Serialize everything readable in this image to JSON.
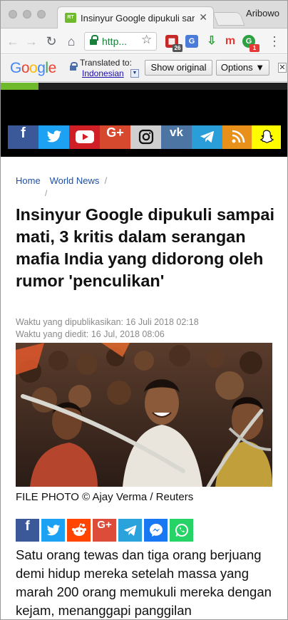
{
  "browser": {
    "tab_title": "Insinyur Google dipukuli samp",
    "tab_favicon_text": "RT",
    "profile_name": "Aribowo",
    "url": "http...",
    "extensions": [
      {
        "name": "calendar-extension",
        "badge": "26",
        "color": "#c62828"
      },
      {
        "name": "google-translate-extension",
        "badge": "",
        "color": "#4a7bd8"
      },
      {
        "name": "download-extension",
        "badge": "",
        "color": "#2e9e3a"
      },
      {
        "name": "m-extension",
        "badge": "",
        "color": "#e53935"
      },
      {
        "name": "grammarly-extension",
        "badge": "1",
        "color": "#2ea043"
      }
    ]
  },
  "translate_bar": {
    "logo": "Google",
    "translated_to": "Translated to:",
    "language": "Indonesian",
    "show_original": "Show original",
    "options": "Options ▼",
    "close": "✕"
  },
  "social": [
    {
      "name": "facebook",
      "glyph": "f",
      "color": "#3b5998"
    },
    {
      "name": "twitter",
      "glyph": "🐦",
      "color": "#1da1f2"
    },
    {
      "name": "youtube",
      "glyph": "▶",
      "color": "#d01f25"
    },
    {
      "name": "google-plus",
      "glyph": "G+",
      "color": "#d6492f"
    },
    {
      "name": "instagram",
      "glyph": "◎",
      "color": "#cfcfcf"
    },
    {
      "name": "vk",
      "glyph": "vk",
      "color": "#4c75a3"
    },
    {
      "name": "telegram",
      "glyph": "➤",
      "color": "#2a9ed8"
    },
    {
      "name": "rss",
      "glyph": "◝",
      "color": "#e8901a"
    },
    {
      "name": "snapchat",
      "glyph": "👻",
      "color": "#fffc00"
    }
  ],
  "article": {
    "breadcrumbs": [
      "Home",
      "World News"
    ],
    "headline": "Insinyur Google dipukuli sampai mati, 3 kritis dalam serangan mafia India yang didorong oleh rumor 'penculikan'",
    "published": "Waktu yang dipublikasikan: 16 Juli 2018 02:18",
    "edited": "Waktu yang diedit: 16 Jul, 2018 08:06",
    "photo_caption": "FILE PHOTO © Ajay Verma / Reuters",
    "body": "Satu orang tewas dan tiga orang berjuang demi hidup mereka setelah massa yang marah 200 orang memukuli mereka dengan kejam, menanggapi panggilan"
  },
  "share_buttons": [
    {
      "name": "share-facebook",
      "glyph": "f",
      "color": "#3b5998"
    },
    {
      "name": "share-twitter",
      "glyph": "🐦",
      "color": "#1da1f2"
    },
    {
      "name": "share-reddit",
      "glyph": "👽",
      "color": "#ff4500"
    },
    {
      "name": "share-google-plus",
      "glyph": "G+",
      "color": "#dd4b39"
    },
    {
      "name": "share-telegram",
      "glyph": "➤",
      "color": "#2aa3dd"
    },
    {
      "name": "share-messenger",
      "glyph": "⚡",
      "color": "#1877f2"
    },
    {
      "name": "share-whatsapp",
      "glyph": "✆",
      "color": "#25d366"
    }
  ]
}
